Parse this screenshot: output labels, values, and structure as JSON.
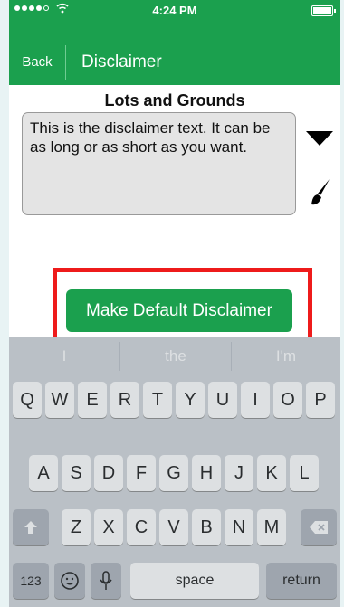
{
  "status_bar": {
    "time": "4:24 PM",
    "wifi_icon": "wifi-icon",
    "battery_icon": "battery-icon"
  },
  "nav": {
    "back_label": "Back",
    "title": "Disclaimer"
  },
  "content": {
    "section_title": "Lots and Grounds",
    "disclaimer_text": "This is the disclaimer text. It can be as long or as short as you want.",
    "dropdown_icon": "triangle-down-icon",
    "brush_icon": "paintbrush-icon",
    "default_button_label": "Make Default Disclaimer"
  },
  "keyboard": {
    "suggestions": [
      "I",
      "the",
      "I'm"
    ],
    "row1": [
      "Q",
      "W",
      "E",
      "R",
      "T",
      "Y",
      "U",
      "I",
      "O",
      "P"
    ],
    "row2": [
      "A",
      "S",
      "D",
      "F",
      "G",
      "H",
      "J",
      "K",
      "L"
    ],
    "row3": [
      "Z",
      "X",
      "C",
      "V",
      "B",
      "N",
      "M"
    ],
    "numbers_label": "123",
    "space_label": "space",
    "return_label": "return",
    "shift_icon": "shift-icon",
    "delete_icon": "delete-icon",
    "emoji_icon": "emoji-icon",
    "mic_icon": "microphone-icon"
  },
  "colors": {
    "brand": "#1ba04e",
    "highlight": "#ee1b1b"
  }
}
